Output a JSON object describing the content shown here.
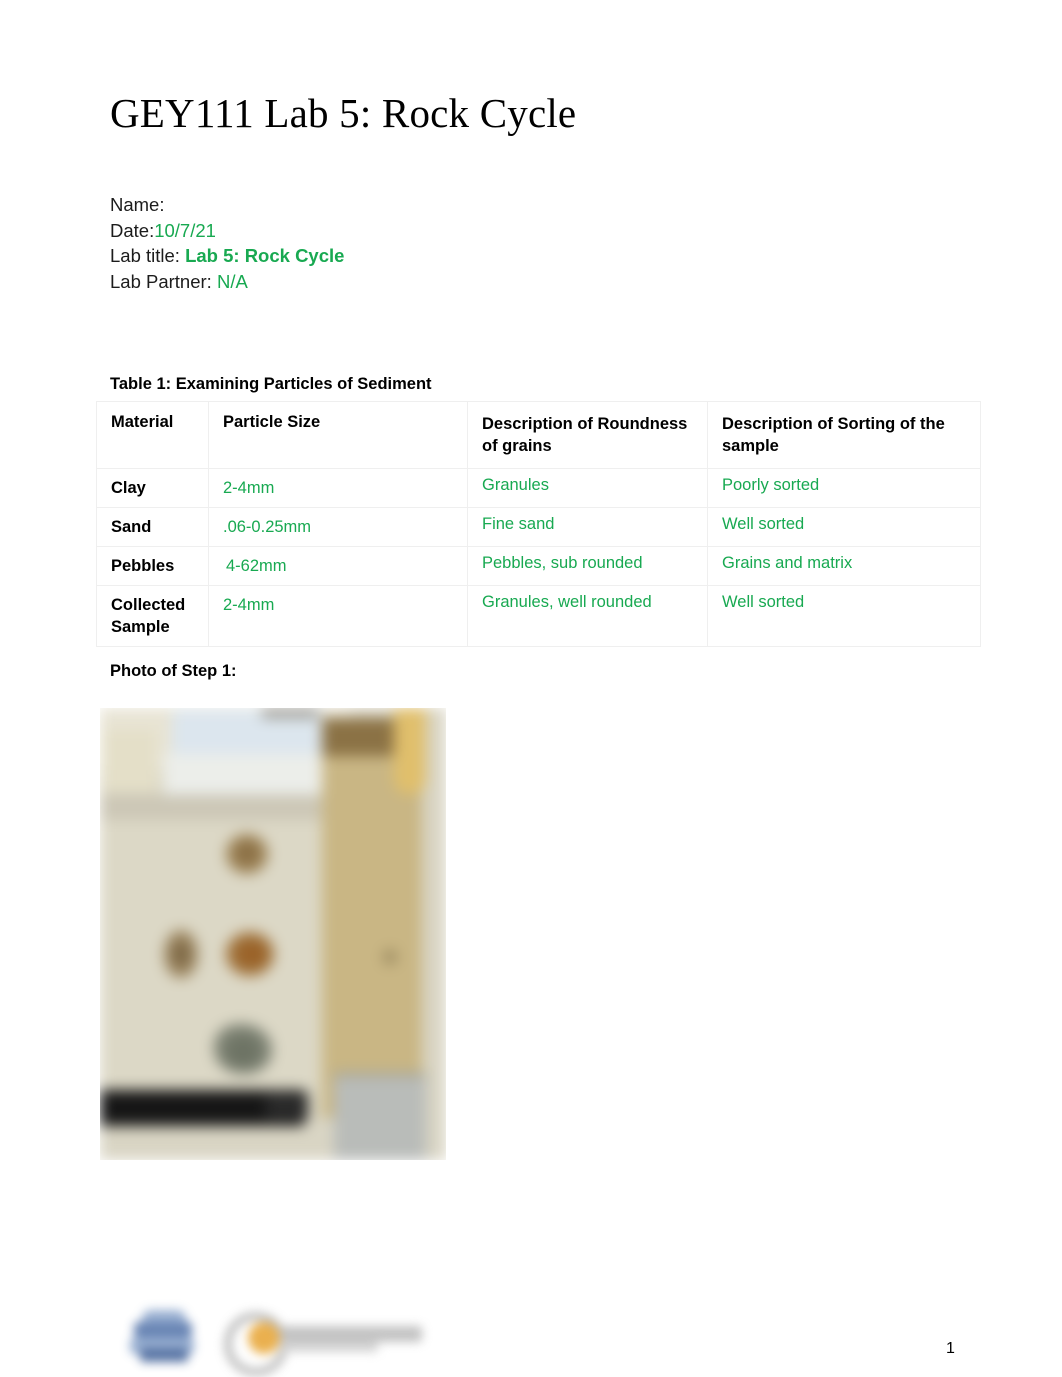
{
  "document": {
    "title": "GEY111 Lab 5: Rock Cycle",
    "page_number": "1"
  },
  "header_info": {
    "name_label": "Name:",
    "name_value": "",
    "date_label": "Date:",
    "date_value": "10/7/21",
    "lab_title_label": "Lab title: ",
    "lab_title_value": "Lab  5: Rock Cycle",
    "lab_partner_label": "Lab Partner: ",
    "lab_partner_value": "N/A"
  },
  "table1": {
    "caption": "Table 1: Examining Particles of Sediment",
    "columns": [
      "Material",
      "Particle Size",
      "Description of Roundness of grains",
      "Description of Sorting of the sample"
    ],
    "rows": [
      {
        "material": "Clay",
        "particle_size": "2-4mm",
        "roundness": "Granules",
        "sorting": "Poorly sorted"
      },
      {
        "material": "Sand",
        "particle_size": ".06-0.25mm",
        "roundness": "Fine sand",
        "sorting": "Well sorted"
      },
      {
        "material": "Pebbles",
        "particle_size": "4-62mm",
        "roundness": "Pebbles, sub rounded",
        "sorting": "Grains and matrix"
      },
      {
        "material": "Collected Sample",
        "particle_size": "2-4mm",
        "roundness": "Granules, well rounded",
        "sorting": "Well sorted"
      }
    ]
  },
  "photo_section": {
    "label": "Photo of Step 1:",
    "image_alt": "Blurred photograph of sediment and rock samples laid out on a beige surface"
  },
  "colors": {
    "answer_green": "#18a951",
    "text_black": "#1a1a1a",
    "table_border": "#efefef"
  }
}
